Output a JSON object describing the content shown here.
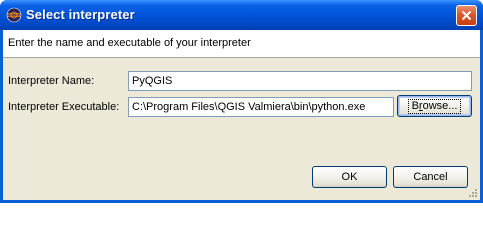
{
  "window": {
    "title": "Select interpreter",
    "app_icon": "eclipse-icon",
    "close_icon": "close-icon"
  },
  "banner": {
    "message": "Enter the name and executable of your interpreter"
  },
  "form": {
    "name_label": "Interpreter Name:",
    "name_value": "PyQGIS",
    "exe_label": "Interpreter Executable:",
    "exe_value": "C:\\Program Files\\QGIS Valmiera\\bin\\python.exe",
    "browse_label_pre": "B",
    "browse_label_mnemonic": "r",
    "browse_label_post": "owse..."
  },
  "buttons": {
    "ok_label": "OK",
    "cancel_label": "Cancel"
  },
  "colors": {
    "title_bar": "#0054e3",
    "dialog_bg": "#ece9d8",
    "close_button": "#d9582d",
    "field_border": "#7f9db9"
  }
}
